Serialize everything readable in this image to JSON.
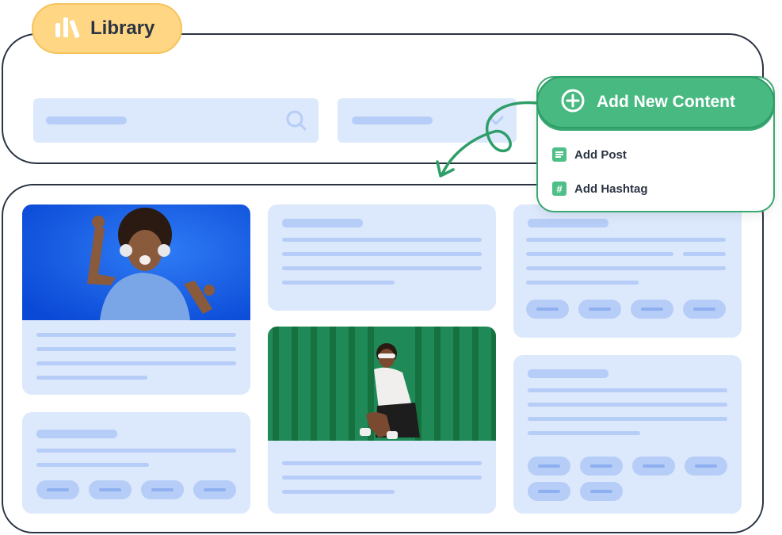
{
  "library": {
    "title": "Library"
  },
  "popup": {
    "title": "Add New Content",
    "items": [
      {
        "label": "Add Post"
      },
      {
        "label": "Add Hashtag"
      }
    ]
  },
  "colors": {
    "accent_green": "#48b981",
    "badge_yellow": "#ffd683",
    "card_blue": "#dce8fc",
    "placeholder_blue": "#b6cdf7",
    "outline": "#2b3442"
  },
  "icons": [
    "library-icon",
    "search-icon",
    "chevron-down-icon",
    "plus-circle-icon",
    "post-icon",
    "hashtag-icon",
    "curved-arrow-icon"
  ]
}
